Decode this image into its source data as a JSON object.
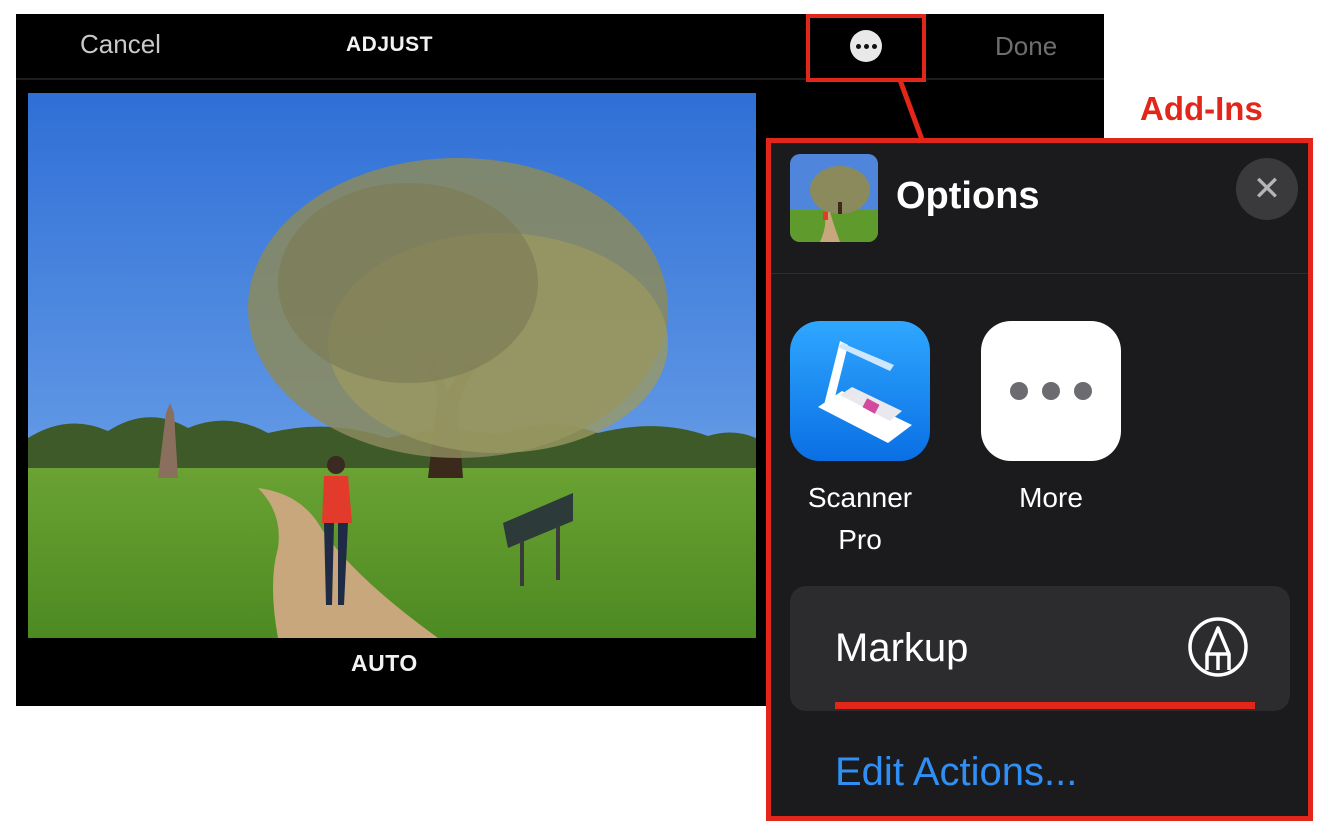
{
  "editor": {
    "cancel_label": "Cancel",
    "mode_label": "ADJUST",
    "done_label": "Done",
    "more_button_icon": "ellipsis-circle-icon",
    "footer_label": "AUTO"
  },
  "annotation": {
    "label": "Add-Ins",
    "color": "#e3261a"
  },
  "options_sheet": {
    "title": "Options",
    "close_icon": "close-icon",
    "apps": [
      {
        "label": "Scanner Pro",
        "icon": "scanner-pro-icon"
      },
      {
        "label": "More",
        "icon": "more-icon"
      }
    ],
    "actions": [
      {
        "label": "Markup",
        "icon": "markup-pen-icon"
      }
    ],
    "edit_actions_label": "Edit Actions...",
    "link_color": "#2f8ff5"
  }
}
